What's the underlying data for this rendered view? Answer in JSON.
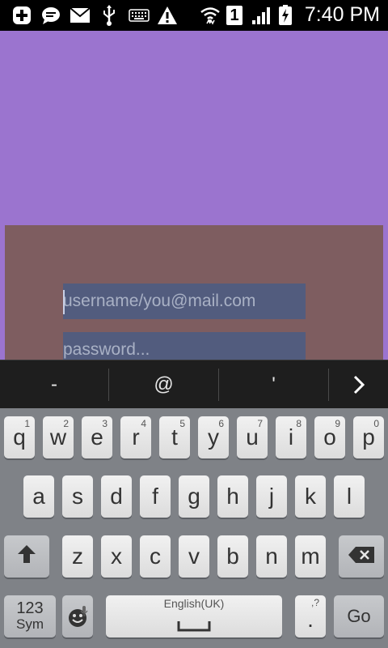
{
  "status_bar": {
    "time": "7:40 PM",
    "sim_number": "1",
    "icons": [
      "add-notification-icon",
      "chat-icon",
      "mail-icon",
      "usb-icon",
      "keyboard-icon",
      "warning-icon",
      "wifi-icon",
      "sim-icon",
      "signal-icon",
      "battery-charging-icon"
    ]
  },
  "login": {
    "username_placeholder": "username/you@mail.com",
    "password_placeholder": "password..."
  },
  "suggestions": [
    "-",
    "@",
    "'"
  ],
  "keyboard": {
    "row1": [
      {
        "k": "q",
        "n": "1"
      },
      {
        "k": "w",
        "n": "2"
      },
      {
        "k": "e",
        "n": "3"
      },
      {
        "k": "r",
        "n": "4"
      },
      {
        "k": "t",
        "n": "5"
      },
      {
        "k": "y",
        "n": "6"
      },
      {
        "k": "u",
        "n": "7"
      },
      {
        "k": "i",
        "n": "8"
      },
      {
        "k": "o",
        "n": "9"
      },
      {
        "k": "p",
        "n": "0"
      }
    ],
    "row2": [
      "a",
      "s",
      "d",
      "f",
      "g",
      "h",
      "j",
      "k",
      "l"
    ],
    "row3": [
      "z",
      "x",
      "c",
      "v",
      "b",
      "n",
      "m"
    ],
    "sym_top": "123",
    "sym_bottom": "Sym",
    "space_label": "English(UK)",
    "period_key": ".",
    "period_hint": ",?",
    "go_label": "Go"
  }
}
